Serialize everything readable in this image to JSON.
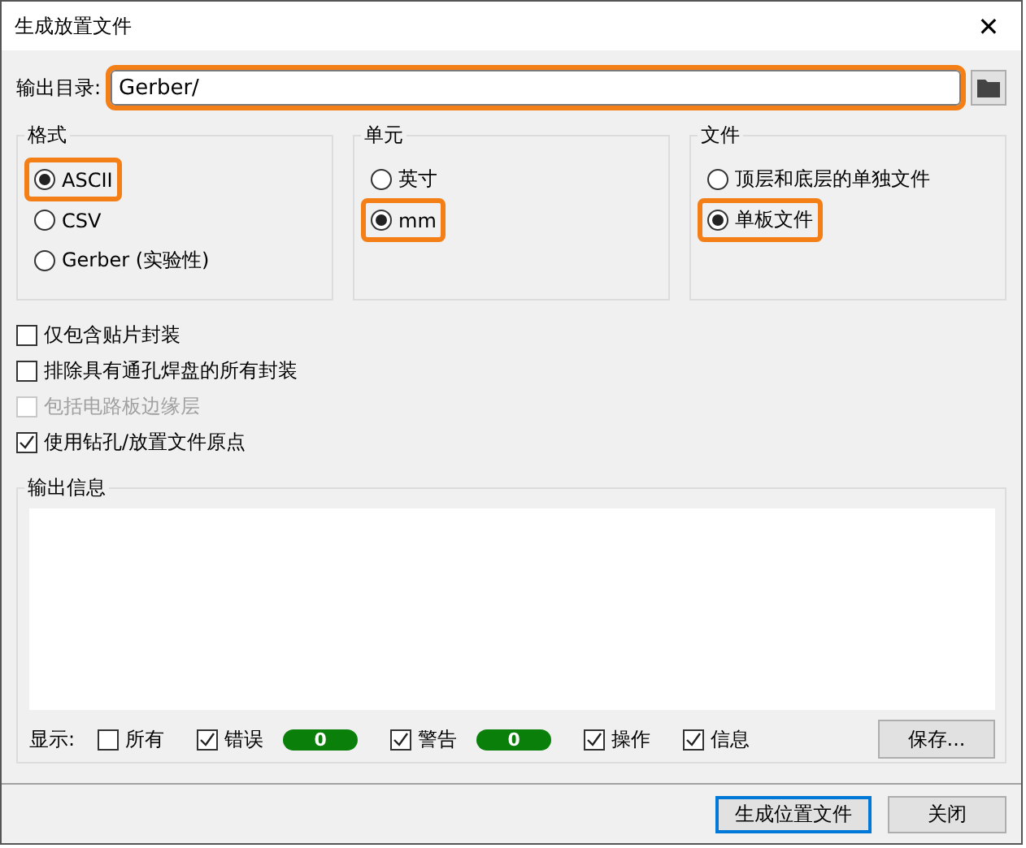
{
  "window": {
    "title": "生成放置文件",
    "close": "✕"
  },
  "output_dir": {
    "label": "输出目录:",
    "value": "Gerber/",
    "highlighted": true
  },
  "groups": [
    {
      "title": "格式",
      "options": [
        {
          "label": "ASCII",
          "selected": true,
          "highlighted": true
        },
        {
          "label": "CSV",
          "selected": false,
          "highlighted": false
        },
        {
          "label": "Gerber (实验性)",
          "selected": false,
          "highlighted": false
        }
      ]
    },
    {
      "title": "单元",
      "options": [
        {
          "label": "英寸",
          "selected": false,
          "highlighted": false
        },
        {
          "label": "mm",
          "selected": true,
          "highlighted": true
        }
      ]
    },
    {
      "title": "文件",
      "options": [
        {
          "label": "顶层和底层的单独文件",
          "selected": false,
          "highlighted": false
        },
        {
          "label": "单板文件",
          "selected": true,
          "highlighted": true
        }
      ]
    }
  ],
  "checkboxes": [
    {
      "label": "仅包含贴片封装",
      "checked": false,
      "disabled": false
    },
    {
      "label": "排除具有通孔焊盘的所有封装",
      "checked": false,
      "disabled": false
    },
    {
      "label": "包括电路板边缘层",
      "checked": false,
      "disabled": true
    },
    {
      "label": "使用钻孔/放置文件原点",
      "checked": true,
      "disabled": false
    }
  ],
  "messages": {
    "title": "输出信息",
    "show_label": "显示:",
    "filters": [
      {
        "label": "所有",
        "checked": false
      },
      {
        "label": "错误",
        "checked": true,
        "count": "0"
      },
      {
        "label": "警告",
        "checked": true,
        "count": "0"
      },
      {
        "label": "操作",
        "checked": true
      },
      {
        "label": "信息",
        "checked": true
      }
    ],
    "save_button": "保存..."
  },
  "buttons": [
    {
      "label": "生成位置文件",
      "default": true
    },
    {
      "label": "关闭",
      "default": false
    }
  ]
}
